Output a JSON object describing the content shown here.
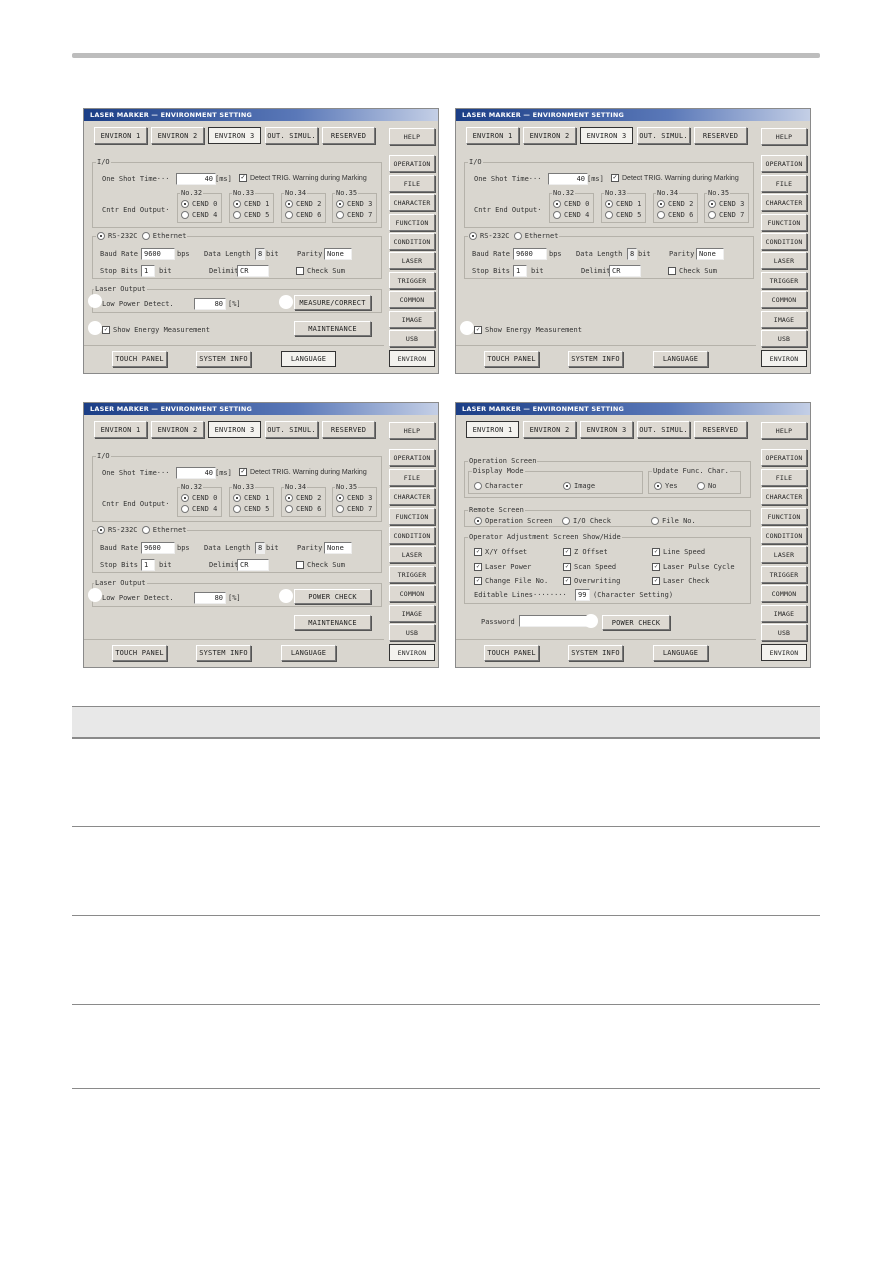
{
  "window_title": "LASER MARKER  —  ENVIRONMENT SETTING",
  "tabs": [
    "ENVIRON 1",
    "ENVIRON 2",
    "ENVIRON 3",
    "OUT. SIMUL.",
    "RESERVED"
  ],
  "side_buttons": [
    "HELP",
    "OPERATION",
    "FILE",
    "CHARACTER",
    "FUNCTION",
    "CONDITION",
    "LASER",
    "TRIGGER",
    "COMMON",
    "IMAGE",
    "USB",
    "ENVIRON"
  ],
  "bottom_buttons": [
    "TOUCH PANEL",
    "SYSTEM INFO",
    "LANGUAGE"
  ],
  "io": {
    "legend": "I/O",
    "one_shot_label": "One Shot Time···",
    "one_shot_value": "40",
    "one_shot_unit": "[ms]",
    "detect_trig_label": "Detect TRIG. Warning during Marking",
    "cntr_end_label": "Cntr End Output·",
    "groups": [
      {
        "title": "No.32",
        "opt1": "CEND 0",
        "opt2": "CEND 4"
      },
      {
        "title": "No.33",
        "opt1": "CEND 1",
        "opt2": "CEND 5"
      },
      {
        "title": "No.34",
        "opt1": "CEND 2",
        "opt2": "CEND 6"
      },
      {
        "title": "No.35",
        "opt1": "CEND 3",
        "opt2": "CEND 7"
      }
    ]
  },
  "comm": {
    "rs232c": "RS-232C",
    "ethernet": "Ethernet",
    "baud_label": "Baud Rate",
    "baud_value": "9600",
    "baud_unit": "bps",
    "data_length_label": "Data Length",
    "data_length_value": "8",
    "data_length_unit": "bit",
    "parity_label": "Parity",
    "parity_value": "None",
    "stop_bits_label": "Stop Bits",
    "stop_bits_value": "1",
    "stop_bits_unit": "bit",
    "delimit_label": "Delimit",
    "delimit_value": "CR",
    "check_sum_label": "Check Sum"
  },
  "laser_output": {
    "legend": "Laser Output",
    "low_power_label": "Low Power Detect.",
    "low_power_value": "80",
    "low_power_unit": "[%]"
  },
  "measure_correct": "MEASURE/CORRECT",
  "power_check": "POWER CHECK",
  "maintenance": "MAINTENANCE",
  "show_energy": "Show Energy Measurement",
  "environ1": {
    "operation_screen": "Operation Screen",
    "display_mode": "Display Mode",
    "character": "Character",
    "image": "Image",
    "update_func": "Update Func. Char.",
    "yes": "Yes",
    "no": "No",
    "remote_screen": "Remote Screen",
    "remote_opts": [
      "Operation Screen",
      "I/O Check",
      "File No."
    ],
    "operator_adjust": "Operator Adjustment Screen Show/Hide",
    "checks": [
      "X/Y Offset",
      "Z Offset",
      "Line Speed",
      "Laser Power",
      "Scan Speed",
      "Laser Pulse Cycle",
      "Change File No.",
      "Overwriting",
      "Laser Check"
    ],
    "editable_lines_label": "Editable Lines········",
    "editable_lines_value": "99",
    "editable_lines_note": "(Character Setting)",
    "password_label": "Password",
    "password_value": ""
  }
}
